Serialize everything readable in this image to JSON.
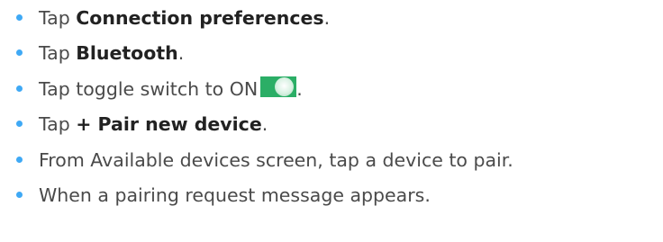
{
  "colors": {
    "bullet": "#3fa9f5",
    "text": "#4a4a4a",
    "toggle_on": "#2bae66"
  },
  "steps": [
    {
      "pre": "Tap ",
      "bold": "Connection preferences",
      "post": "."
    },
    {
      "pre": "Tap ",
      "bold": "Bluetooth",
      "post": "."
    },
    {
      "pre": "Tap toggle switch to ON",
      "icon": "toggle-switch-on-icon",
      "post": "."
    },
    {
      "pre": "Tap ",
      "bold": "+ Pair new device",
      "post": "."
    },
    {
      "text": "From Available devices screen, tap a device to pair."
    },
    {
      "text": "When a pairing request message appears."
    }
  ]
}
